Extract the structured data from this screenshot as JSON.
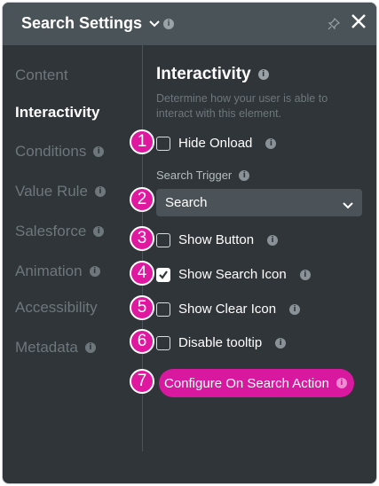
{
  "header": {
    "title": "Search Settings",
    "info": "i"
  },
  "sidebar": {
    "items": [
      {
        "label": "Content",
        "info": ""
      },
      {
        "label": "Interactivity",
        "info": ""
      },
      {
        "label": "Conditions",
        "info": "i"
      },
      {
        "label": "Value Rule",
        "info": "i"
      },
      {
        "label": "Salesforce",
        "info": "i"
      },
      {
        "label": "Animation",
        "info": "i"
      },
      {
        "label": "Accessibility",
        "info": ""
      },
      {
        "label": "Metadata",
        "info": "i"
      }
    ],
    "active": "Interactivity"
  },
  "section": {
    "title": "Interactivity",
    "description": "Determine how your user is able to interact with this element."
  },
  "options": {
    "hide_onload": {
      "label": "Hide Onload",
      "checked": false
    },
    "search_trigger": {
      "label": "Search Trigger",
      "value": "Search"
    },
    "show_button": {
      "label": "Show Button",
      "checked": false
    },
    "show_search_icon": {
      "label": "Show Search Icon",
      "checked": true
    },
    "show_clear_icon": {
      "label": "Show Clear Icon",
      "checked": false
    },
    "disable_tooltip": {
      "label": "Disable tooltip",
      "checked": false
    }
  },
  "action_button": {
    "label": "Configure On Search Action"
  },
  "info_glyph": "i",
  "badges": [
    "1",
    "2",
    "3",
    "4",
    "5",
    "6",
    "7"
  ],
  "colors": {
    "accent": "#d8199f",
    "panel": "#2f3539",
    "header": "#4a5358"
  }
}
